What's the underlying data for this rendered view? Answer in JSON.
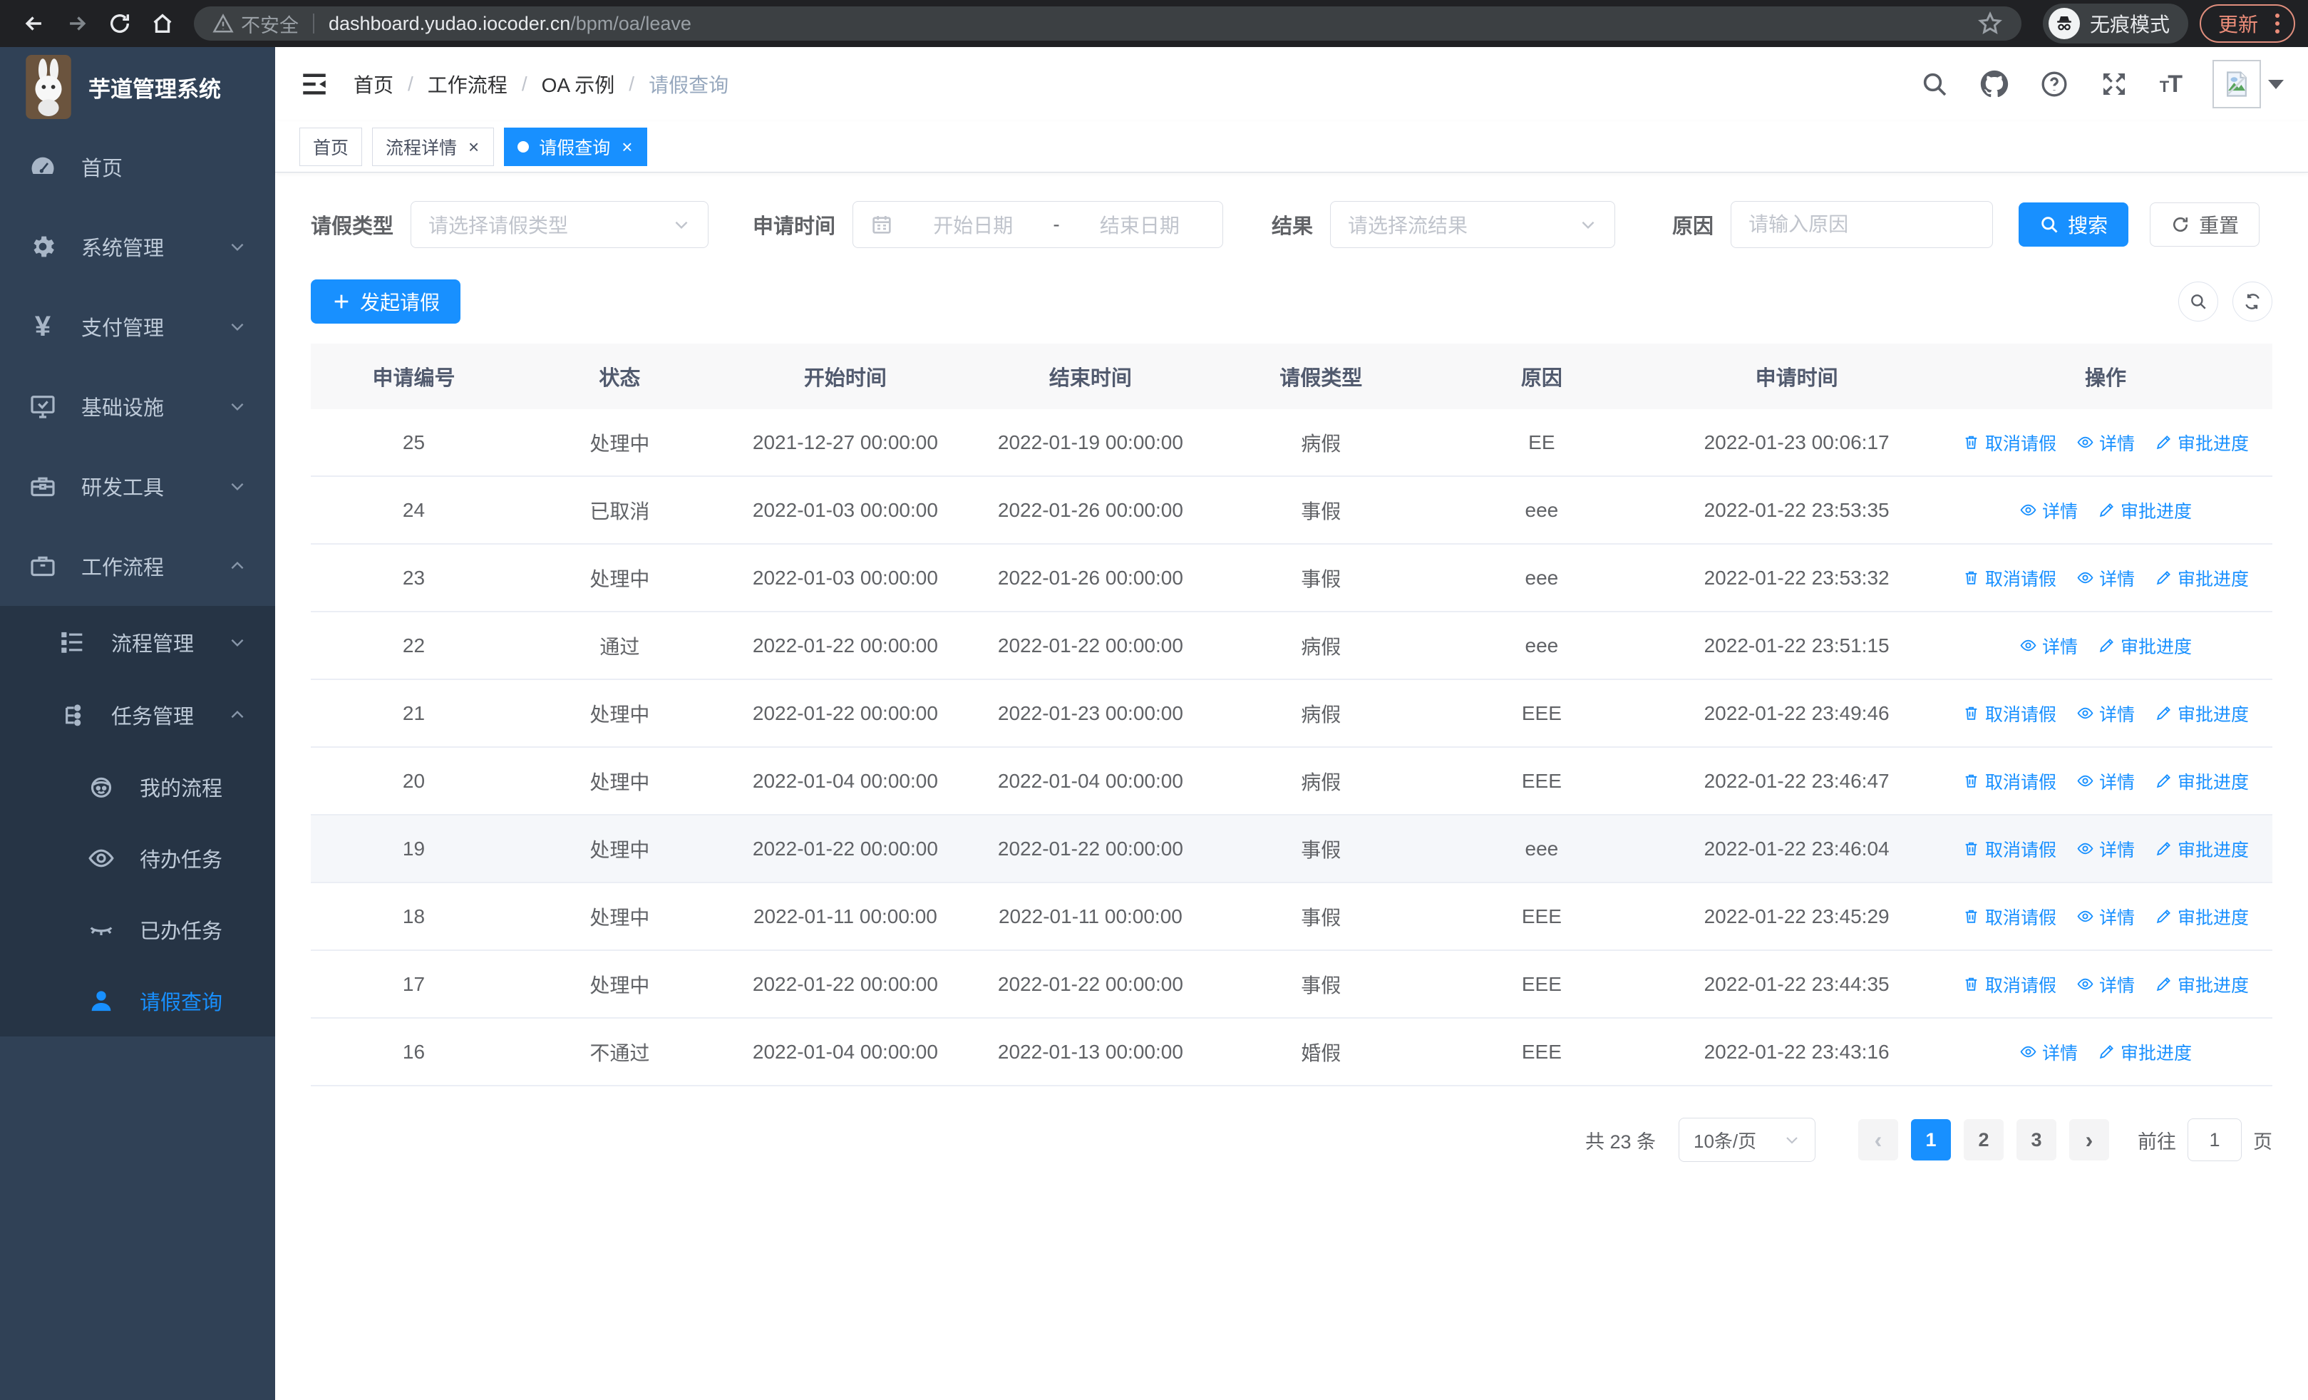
{
  "browser": {
    "security_label": "不安全",
    "url_host": "dashboard.yudao.iocoder.cn",
    "url_path": "/bpm/oa/leave",
    "incognito_label": "无痕模式",
    "update_label": "更新"
  },
  "app": {
    "title": "芋道管理系统"
  },
  "sidebar": {
    "items": [
      {
        "key": "home",
        "label": "首页",
        "icon": "dashboard",
        "arrow": ""
      },
      {
        "key": "system",
        "label": "系统管理",
        "icon": "gear",
        "arrow": "down"
      },
      {
        "key": "payment",
        "label": "支付管理",
        "icon": "yen",
        "arrow": "down"
      },
      {
        "key": "infra",
        "label": "基础设施",
        "icon": "monitor",
        "arrow": "down"
      },
      {
        "key": "devtools",
        "label": "研发工具",
        "icon": "toolbox",
        "arrow": "down"
      },
      {
        "key": "workflow",
        "label": "工作流程",
        "icon": "briefcase",
        "arrow": "up",
        "expanded": true
      }
    ],
    "submenu": [
      {
        "key": "process-mgmt",
        "label": "流程管理",
        "icon": "list",
        "arrow": "down",
        "level": 1
      },
      {
        "key": "task-mgmt",
        "label": "任务管理",
        "icon": "tree",
        "arrow": "up",
        "level": 1
      },
      {
        "key": "my-process",
        "label": "我的流程",
        "icon": "face",
        "level": 2
      },
      {
        "key": "todo-tasks",
        "label": "待办任务",
        "icon": "eye",
        "level": 2
      },
      {
        "key": "done-tasks",
        "label": "已办任务",
        "icon": "eye-closed",
        "level": 2
      },
      {
        "key": "leave-query",
        "label": "请假查询",
        "icon": "user",
        "level": 2,
        "active": true
      }
    ]
  },
  "breadcrumb": [
    "首页",
    "工作流程",
    "OA 示例",
    "请假查询"
  ],
  "tabs": [
    {
      "key": "home",
      "label": "首页",
      "closable": false,
      "active": false
    },
    {
      "key": "process-detail",
      "label": "流程详情",
      "closable": true,
      "active": false
    },
    {
      "key": "leave-query",
      "label": "请假查询",
      "closable": true,
      "active": true
    }
  ],
  "filters": {
    "leave_type_label": "请假类型",
    "leave_type_placeholder": "请选择请假类型",
    "apply_time_label": "申请时间",
    "date_start_placeholder": "开始日期",
    "date_separator": "-",
    "date_end_placeholder": "结束日期",
    "result_label": "结果",
    "result_placeholder": "请选择流结果",
    "reason_label": "原因",
    "reason_placeholder": "请输入原因",
    "search_label": "搜索",
    "reset_label": "重置"
  },
  "toolbar": {
    "create_label": "发起请假"
  },
  "table": {
    "columns": [
      "申请编号",
      "状态",
      "开始时间",
      "结束时间",
      "请假类型",
      "原因",
      "申请时间",
      "操作"
    ],
    "action_labels": {
      "cancel": "取消请假",
      "detail": "详情",
      "progress": "审批进度"
    },
    "rows": [
      {
        "id": "25",
        "status": "处理中",
        "start": "2021-12-27 00:00:00",
        "end": "2022-01-19 00:00:00",
        "type": "病假",
        "reason": "EE",
        "applied": "2022-01-23 00:06:17",
        "actions": [
          "cancel",
          "detail",
          "progress"
        ],
        "highlight": false
      },
      {
        "id": "24",
        "status": "已取消",
        "start": "2022-01-03 00:00:00",
        "end": "2022-01-26 00:00:00",
        "type": "事假",
        "reason": "eee",
        "applied": "2022-01-22 23:53:35",
        "actions": [
          "detail",
          "progress"
        ],
        "highlight": false
      },
      {
        "id": "23",
        "status": "处理中",
        "start": "2022-01-03 00:00:00",
        "end": "2022-01-26 00:00:00",
        "type": "事假",
        "reason": "eee",
        "applied": "2022-01-22 23:53:32",
        "actions": [
          "cancel",
          "detail",
          "progress"
        ],
        "highlight": false
      },
      {
        "id": "22",
        "status": "通过",
        "start": "2022-01-22 00:00:00",
        "end": "2022-01-22 00:00:00",
        "type": "病假",
        "reason": "eee",
        "applied": "2022-01-22 23:51:15",
        "actions": [
          "detail",
          "progress"
        ],
        "highlight": false
      },
      {
        "id": "21",
        "status": "处理中",
        "start": "2022-01-22 00:00:00",
        "end": "2022-01-23 00:00:00",
        "type": "病假",
        "reason": "EEE",
        "applied": "2022-01-22 23:49:46",
        "actions": [
          "cancel",
          "detail",
          "progress"
        ],
        "highlight": false
      },
      {
        "id": "20",
        "status": "处理中",
        "start": "2022-01-04 00:00:00",
        "end": "2022-01-04 00:00:00",
        "type": "病假",
        "reason": "EEE",
        "applied": "2022-01-22 23:46:47",
        "actions": [
          "cancel",
          "detail",
          "progress"
        ],
        "highlight": false
      },
      {
        "id": "19",
        "status": "处理中",
        "start": "2022-01-22 00:00:00",
        "end": "2022-01-22 00:00:00",
        "type": "事假",
        "reason": "eee",
        "applied": "2022-01-22 23:46:04",
        "actions": [
          "cancel",
          "detail",
          "progress"
        ],
        "highlight": true
      },
      {
        "id": "18",
        "status": "处理中",
        "start": "2022-01-11 00:00:00",
        "end": "2022-01-11 00:00:00",
        "type": "事假",
        "reason": "EEE",
        "applied": "2022-01-22 23:45:29",
        "actions": [
          "cancel",
          "detail",
          "progress"
        ],
        "highlight": false
      },
      {
        "id": "17",
        "status": "处理中",
        "start": "2022-01-22 00:00:00",
        "end": "2022-01-22 00:00:00",
        "type": "事假",
        "reason": "EEE",
        "applied": "2022-01-22 23:44:35",
        "actions": [
          "cancel",
          "detail",
          "progress"
        ],
        "highlight": false
      },
      {
        "id": "16",
        "status": "不通过",
        "start": "2022-01-04 00:00:00",
        "end": "2022-01-13 00:00:00",
        "type": "婚假",
        "reason": "EEE",
        "applied": "2022-01-22 23:43:16",
        "actions": [
          "detail",
          "progress"
        ],
        "highlight": false
      }
    ]
  },
  "pagination": {
    "total_text": "共 23 条",
    "page_size": "10条/页",
    "pages": [
      "1",
      "2",
      "3"
    ],
    "active_page": "1",
    "goto_label": "前往",
    "goto_value": "1",
    "page_label": "页"
  },
  "colors": {
    "primary": "#1890ff",
    "sidebar_bg": "#304156",
    "sidebar_submenu_bg": "#263445",
    "active_link": "#1890ff",
    "update_button": "#ec8d79"
  }
}
